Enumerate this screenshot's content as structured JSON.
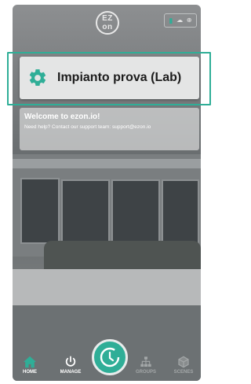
{
  "header": {
    "logo_text": "EZ\non",
    "status_items": [
      "wifi",
      "cloud",
      "globe"
    ]
  },
  "plant": {
    "name": "Impianto prova (Lab)",
    "icon": "gear-icon"
  },
  "welcome": {
    "title": "Welcome to ezon.io!",
    "text": "Need help? Contact our support team: support@ezon.io"
  },
  "nav": {
    "home_label": "HOME",
    "manage_label": "MANAGE",
    "groups_label": "GROUPS",
    "scenes_label": "SCENES"
  },
  "colors": {
    "accent": "#2fae97",
    "card_bg": "#e4e5e5",
    "text_dark": "#1c1c1c"
  }
}
